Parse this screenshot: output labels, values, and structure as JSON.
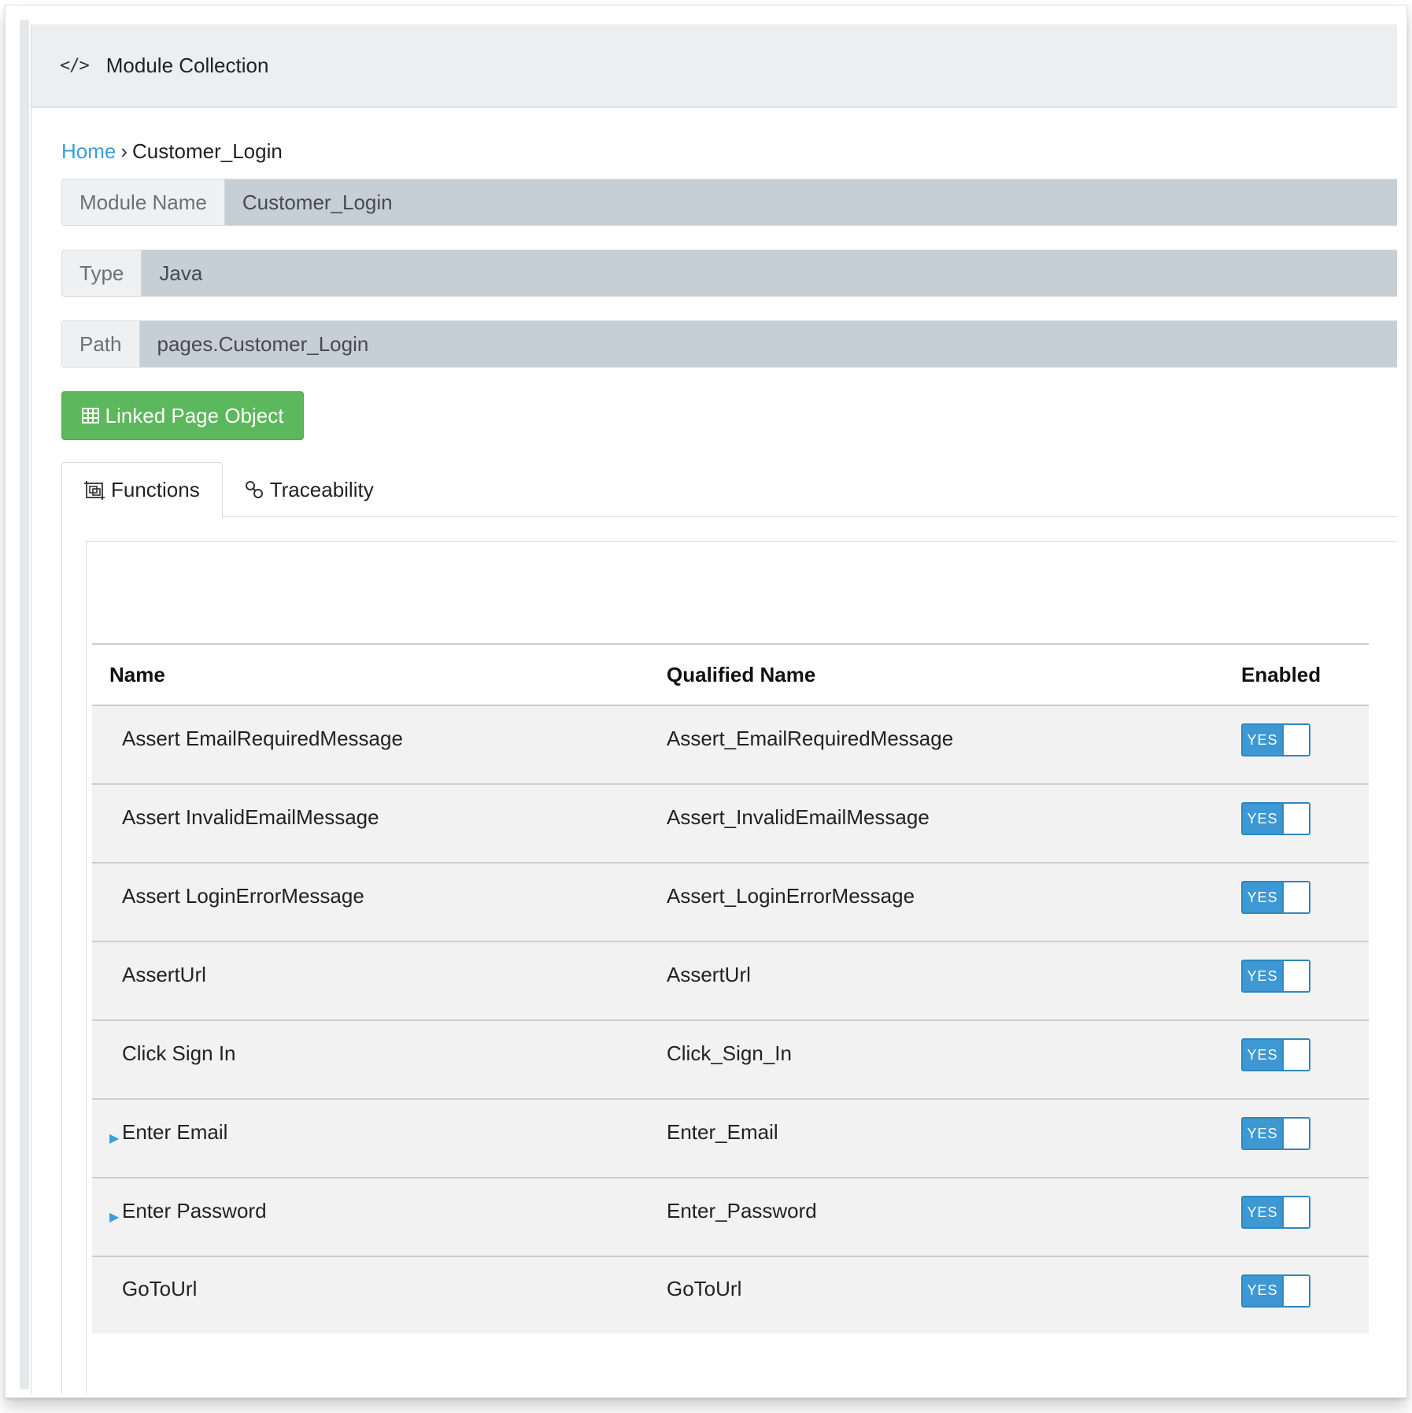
{
  "header": {
    "title": "Module Collection",
    "icon": "code-icon"
  },
  "breadcrumb": {
    "home": "Home",
    "separator": "›",
    "current": "Customer_Login"
  },
  "fields": {
    "module_name": {
      "label": "Module Name",
      "value": "Customer_Login"
    },
    "type": {
      "label": "Type",
      "value": "Java"
    },
    "path": {
      "label": "Path",
      "value": "pages.Customer_Login"
    }
  },
  "linked_button": {
    "label": "Linked Page Object",
    "icon": "table-icon",
    "color": "#5cb85c"
  },
  "tabs": [
    {
      "label": "Functions",
      "icon": "functions-icon",
      "active": true
    },
    {
      "label": "Traceability",
      "icon": "link-icon",
      "active": false
    }
  ],
  "table": {
    "headers": {
      "name": "Name",
      "qualified": "Qualified Name",
      "enabled": "Enabled"
    },
    "rows": [
      {
        "name": "Assert EmailRequiredMessage",
        "qualified": "Assert_EmailRequiredMessage",
        "enabled": "YES",
        "expandable": false
      },
      {
        "name": "Assert InvalidEmailMessage",
        "qualified": "Assert_InvalidEmailMessage",
        "enabled": "YES",
        "expandable": false
      },
      {
        "name": "Assert LoginErrorMessage",
        "qualified": "Assert_LoginErrorMessage",
        "enabled": "YES",
        "expandable": false
      },
      {
        "name": "AssertUrl",
        "qualified": "AssertUrl",
        "enabled": "YES",
        "expandable": false
      },
      {
        "name": "Click Sign In",
        "qualified": "Click_Sign_In",
        "enabled": "YES",
        "expandable": false
      },
      {
        "name": "Enter Email",
        "qualified": "Enter_Email",
        "enabled": "YES",
        "expandable": true
      },
      {
        "name": "Enter Password",
        "qualified": "Enter_Password",
        "enabled": "YES",
        "expandable": true
      },
      {
        "name": "GoToUrl",
        "qualified": "GoToUrl",
        "enabled": "YES",
        "expandable": false
      }
    ]
  },
  "colors": {
    "link": "#3a9fd8",
    "toggle": "#3d98d3",
    "field_value_bg": "#c7cfd6"
  }
}
